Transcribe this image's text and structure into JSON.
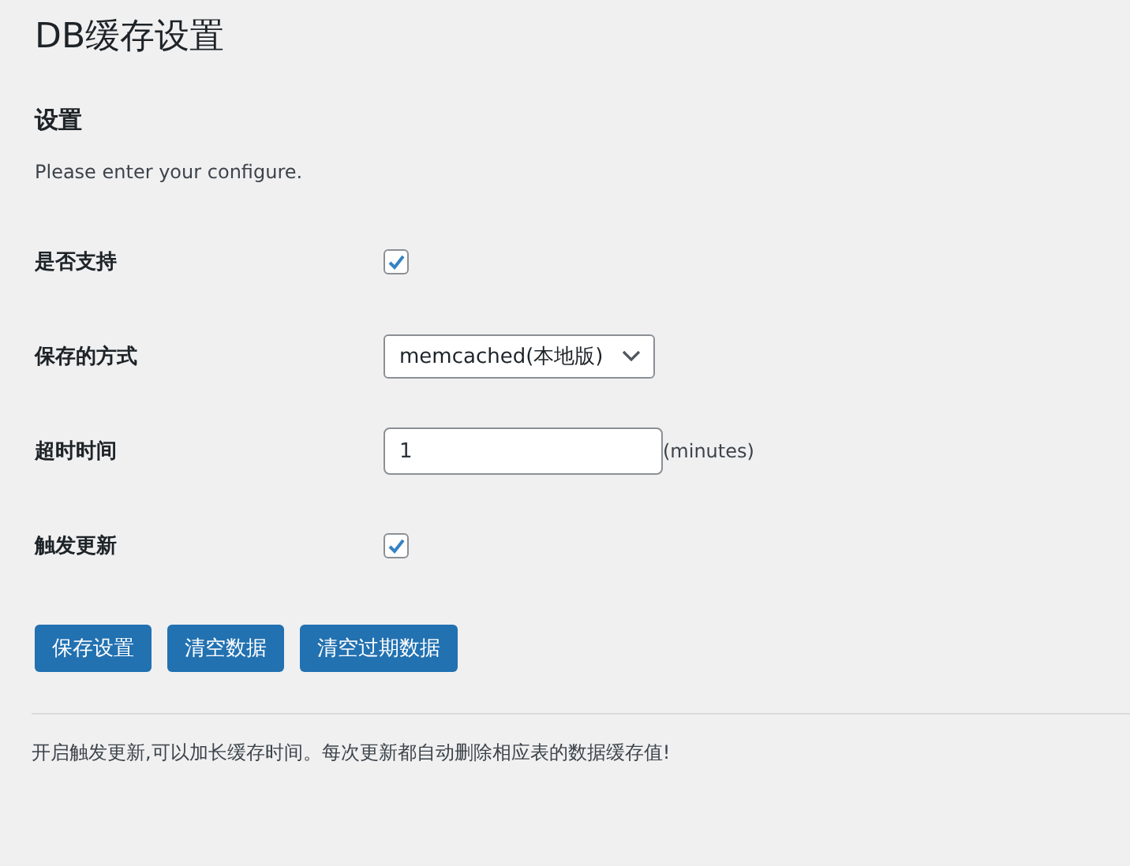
{
  "page_title": "DB缓存设置",
  "section": {
    "heading": "设置",
    "description": "Please enter your configure."
  },
  "fields": [
    {
      "label": "是否支持",
      "kind": "checkbox",
      "checked": true
    },
    {
      "label": "保存的方式",
      "kind": "select",
      "value": "memcached(本地版)"
    },
    {
      "label": "超时时间",
      "kind": "text",
      "value": "1",
      "suffix": "(minutes)"
    },
    {
      "label": "触发更新",
      "kind": "checkbox",
      "checked": true
    }
  ],
  "buttons": [
    "保存设置",
    "清空数据",
    "清空过期数据"
  ],
  "note": "开启触发更新,可以加长缓存时间。每次更新都自动删除相应表的数据缓存值!"
}
